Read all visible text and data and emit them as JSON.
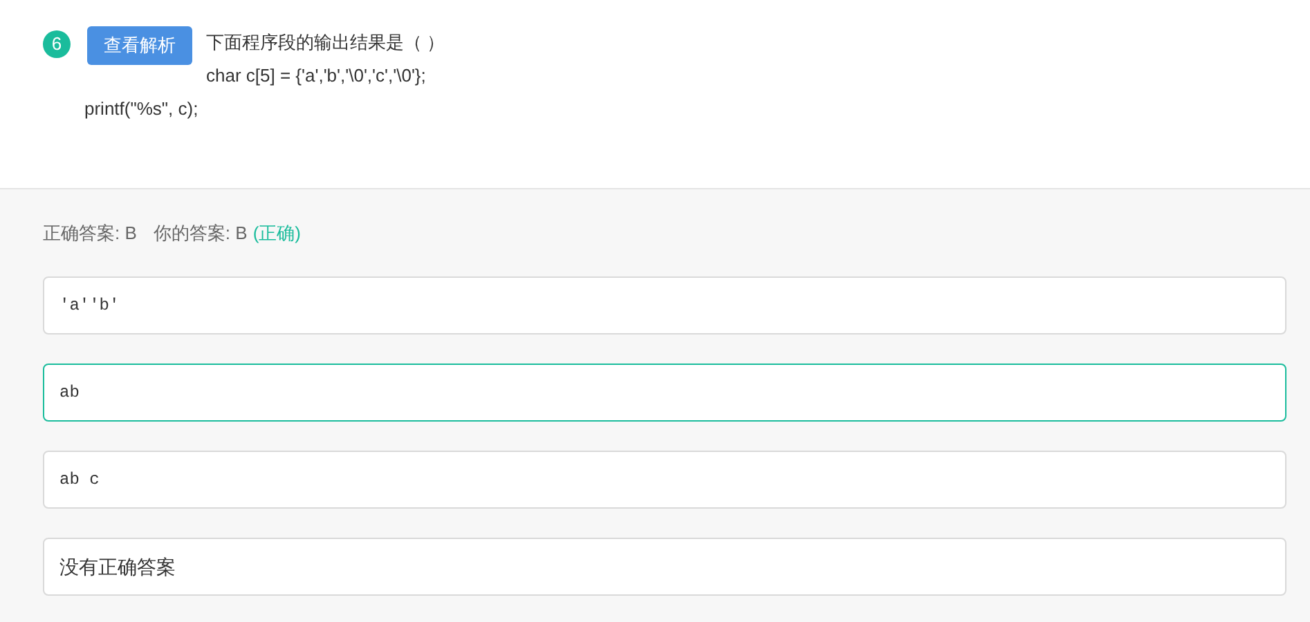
{
  "question": {
    "number": "6",
    "analysis_button": "查看解析",
    "lines": [
      "下面程序段的输出结果是（ ）",
      "char c[5] = {'a','b','\\0','c','\\0'};",
      "printf(\"%s\", c);"
    ]
  },
  "result": {
    "correct_label": "正确答案: B",
    "your_label": "你的答案: B",
    "verdict": "(正确)"
  },
  "options": [
    {
      "kind": "code",
      "text": "'a''b'",
      "selected": false
    },
    {
      "kind": "code",
      "text": "ab",
      "selected": true
    },
    {
      "kind": "code",
      "text": "ab c",
      "selected": false
    },
    {
      "kind": "text",
      "text": "没有正确答案",
      "selected": false
    }
  ]
}
